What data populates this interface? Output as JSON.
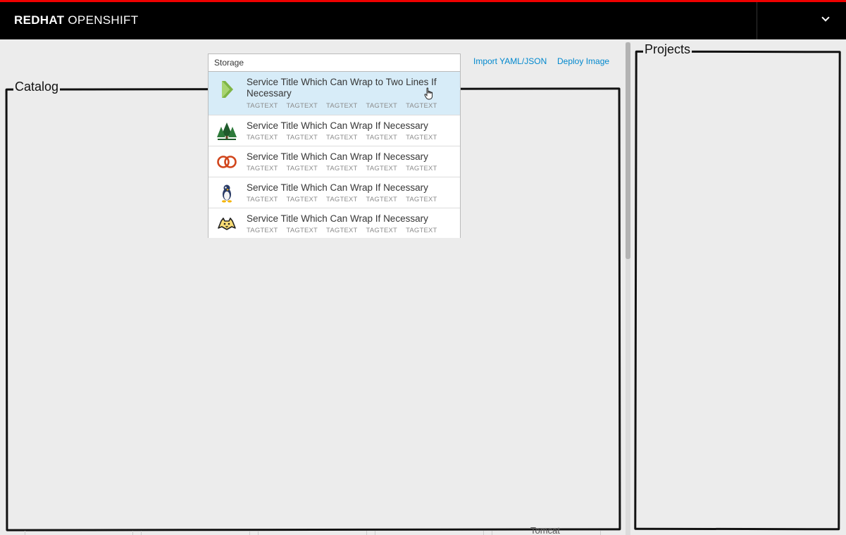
{
  "header": {
    "brand_bold": "REDHAT",
    "brand_light": "OPENSHIFT"
  },
  "panels": {
    "catalog_title": "Catalog",
    "projects_title": "Projects"
  },
  "links": {
    "import": "Import YAML/JSON",
    "deploy": "Deploy Image"
  },
  "search": {
    "value": "Storage"
  },
  "results": [
    {
      "title": "Service Title Which Can Wrap to Two Lines If Necessary",
      "icon": "chevron-logo-icon",
      "tags": [
        "TAGTEXT",
        "TAGTEXT",
        "TAGTEXT",
        "TAGTEXT",
        "TAGTEXT"
      ],
      "active": true
    },
    {
      "title": "Service Title Which Can Wrap If Necessary",
      "icon": "pine-trees-icon",
      "tags": [
        "TAGTEXT",
        "TAGTEXT",
        "TAGTEXT",
        "TAGTEXT",
        "TAGTEXT"
      ]
    },
    {
      "title": "Service Title Which Can Wrap If Necessary",
      "icon": "linked-rings-icon",
      "tags": [
        "TAGTEXT",
        "TAGTEXT",
        "TAGTEXT",
        "TAGTEXT",
        "TAGTEXT"
      ]
    },
    {
      "title": "Service Title Which Can Wrap If Necessary",
      "icon": "penguin-icon",
      "tags": [
        "TAGTEXT",
        "TAGTEXT",
        "TAGTEXT",
        "TAGTEXT",
        "TAGTEXT"
      ]
    },
    {
      "title": "Service Title Which Can Wrap If Necessary",
      "icon": "tomcat-icon",
      "tags": [
        "TAGTEXT",
        "TAGTEXT",
        "TAGTEXT",
        "TAGTEXT",
        "TAGTEXT"
      ]
    }
  ],
  "background": {
    "tomcat_label": "Tomcat"
  },
  "colors": {
    "accent": "#0088ce",
    "topbar_border": "#ee0000",
    "active_row": "#d7ecf8"
  }
}
